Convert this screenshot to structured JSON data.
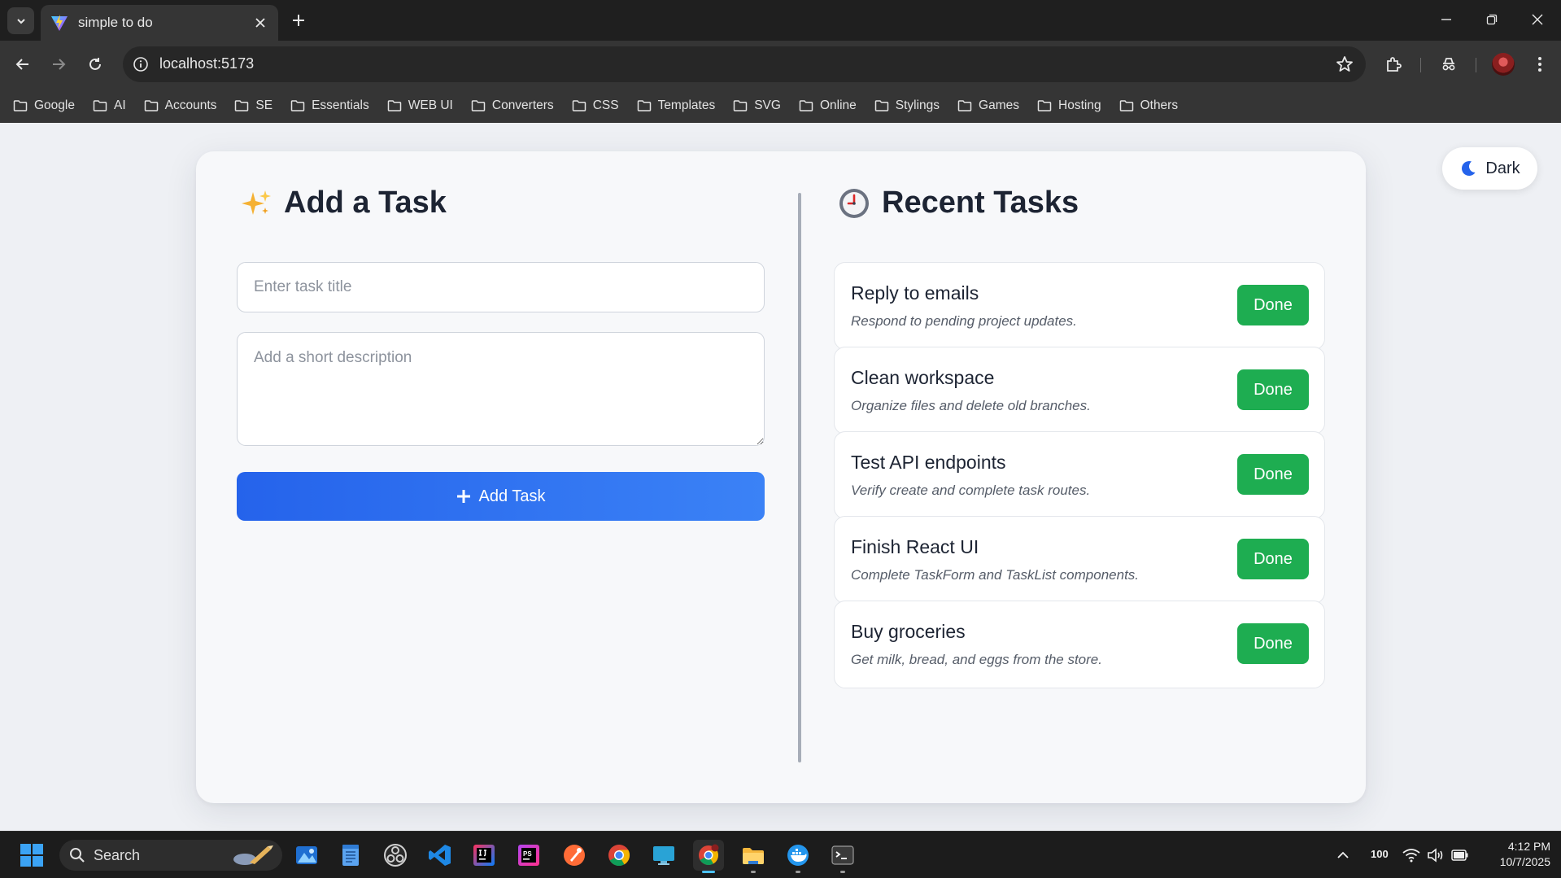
{
  "browser": {
    "tab_title": "simple to do",
    "url": "localhost:5173",
    "bookmarks": [
      "Google",
      "AI",
      "Accounts",
      "SE",
      "Essentials",
      "WEB UI",
      "Converters",
      "CSS",
      "Templates",
      "SVG",
      "Online",
      "Stylings",
      "Games",
      "Hosting",
      "Others"
    ]
  },
  "theme_toggle": {
    "label": "Dark"
  },
  "form": {
    "heading": "Add a Task",
    "title_placeholder": "Enter task title",
    "description_placeholder": "Add a short description",
    "submit_label": "Add Task"
  },
  "recent": {
    "heading": "Recent Tasks",
    "tasks": [
      {
        "title": "Reply to emails",
        "description": "Respond to pending project updates.",
        "action": "Done"
      },
      {
        "title": "Clean workspace",
        "description": "Organize files and delete old branches.",
        "action": "Done"
      },
      {
        "title": "Test API endpoints",
        "description": "Verify create and complete task routes.",
        "action": "Done"
      },
      {
        "title": "Finish React UI",
        "description": "Complete TaskForm and TaskList components.",
        "action": "Done"
      },
      {
        "title": "Buy groceries",
        "description": "Get milk, bread, and eggs from the store.",
        "action": "Done"
      }
    ]
  },
  "taskbar": {
    "search_label": "Search",
    "battery": "100",
    "time": "4:12 PM",
    "date": "10/7/2025"
  },
  "colors": {
    "primary": "#2563eb",
    "success": "#1ead51",
    "heading_text": "#1d2433"
  }
}
